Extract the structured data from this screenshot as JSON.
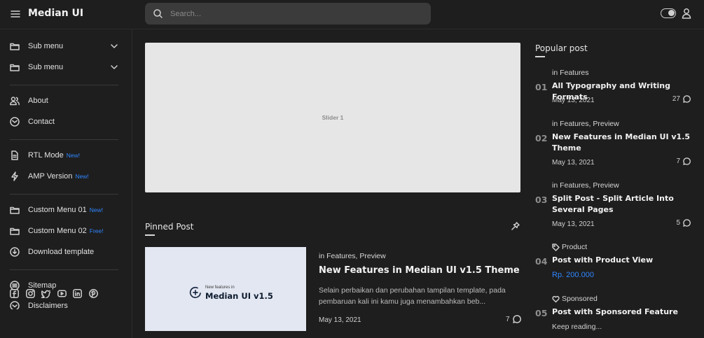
{
  "app": {
    "brand": "Median UI"
  },
  "search": {
    "placeholder": "Search..."
  },
  "sidebar": {
    "items": [
      {
        "label": "Sub menu",
        "icon": "folder-icon",
        "badge": ""
      },
      {
        "label": "Sub menu",
        "icon": "folder-icon",
        "badge": ""
      },
      {
        "label": "About",
        "icon": "users-icon",
        "badge": ""
      },
      {
        "label": "Contact",
        "icon": "mail-icon",
        "badge": ""
      },
      {
        "label": "RTL Mode",
        "icon": "rtl-icon",
        "badge": "New!"
      },
      {
        "label": "AMP Version",
        "icon": "lightning-icon",
        "badge": "New!"
      },
      {
        "label": "Custom Menu 01",
        "icon": "folder-icon",
        "badge": "New!"
      },
      {
        "label": "Custom Menu 02",
        "icon": "folder-icon",
        "badge": "Free!"
      },
      {
        "label": "Download template",
        "icon": "download-icon",
        "badge": ""
      },
      {
        "label": "Sitemap",
        "icon": "sitemap-icon",
        "badge": ""
      },
      {
        "label": "Disclaimers",
        "icon": "disclaimer-icon",
        "badge": ""
      }
    ],
    "social": [
      "facebook-icon",
      "instagram-icon",
      "twitter-icon",
      "youtube-icon",
      "linkedin-icon",
      "pinterest-icon"
    ]
  },
  "slider": {
    "label": "Slider 1"
  },
  "pinned": {
    "section_title": "Pinned Post",
    "thumb_small": "New features in",
    "thumb_big": "Median UI v1.5",
    "meta_prefix": "in",
    "categories": "Features, Preview",
    "title": "New Features in Median UI v1.5 Theme",
    "excerpt": "Selain perbaikan dan perubahan tampilan template, pada pembaruan kali ini kamu juga menambahkan beb...",
    "date": "May 13, 2021",
    "comments": "7"
  },
  "popular": {
    "section_title": "Popular post",
    "posts": [
      {
        "num": "01",
        "meta": "in Features",
        "title": "All Typography and Writing Formats",
        "date": "May 13, 2021",
        "comments": "27"
      },
      {
        "num": "02",
        "meta": "in Features, Preview",
        "title": "New Features in Median UI v1.5 Theme",
        "date": "May 13, 2021",
        "comments": "7"
      },
      {
        "num": "03",
        "meta": "in Features, Preview",
        "title": "Split Post - Split Article Into Several Pages",
        "date": "May 13, 2021",
        "comments": "5"
      },
      {
        "num": "04",
        "meta": "Product",
        "title": "Post with Product View",
        "price": "Rp. 200.000"
      },
      {
        "num": "05",
        "meta": "Sponsored",
        "title": "Post with Sponsored Feature",
        "keep": "Keep reading..."
      }
    ]
  },
  "colors": {
    "background": "#1e1e1e",
    "accent": "#2f86ff",
    "search_bg": "#3b3b3b",
    "slider_bg": "#e6e6e6"
  }
}
